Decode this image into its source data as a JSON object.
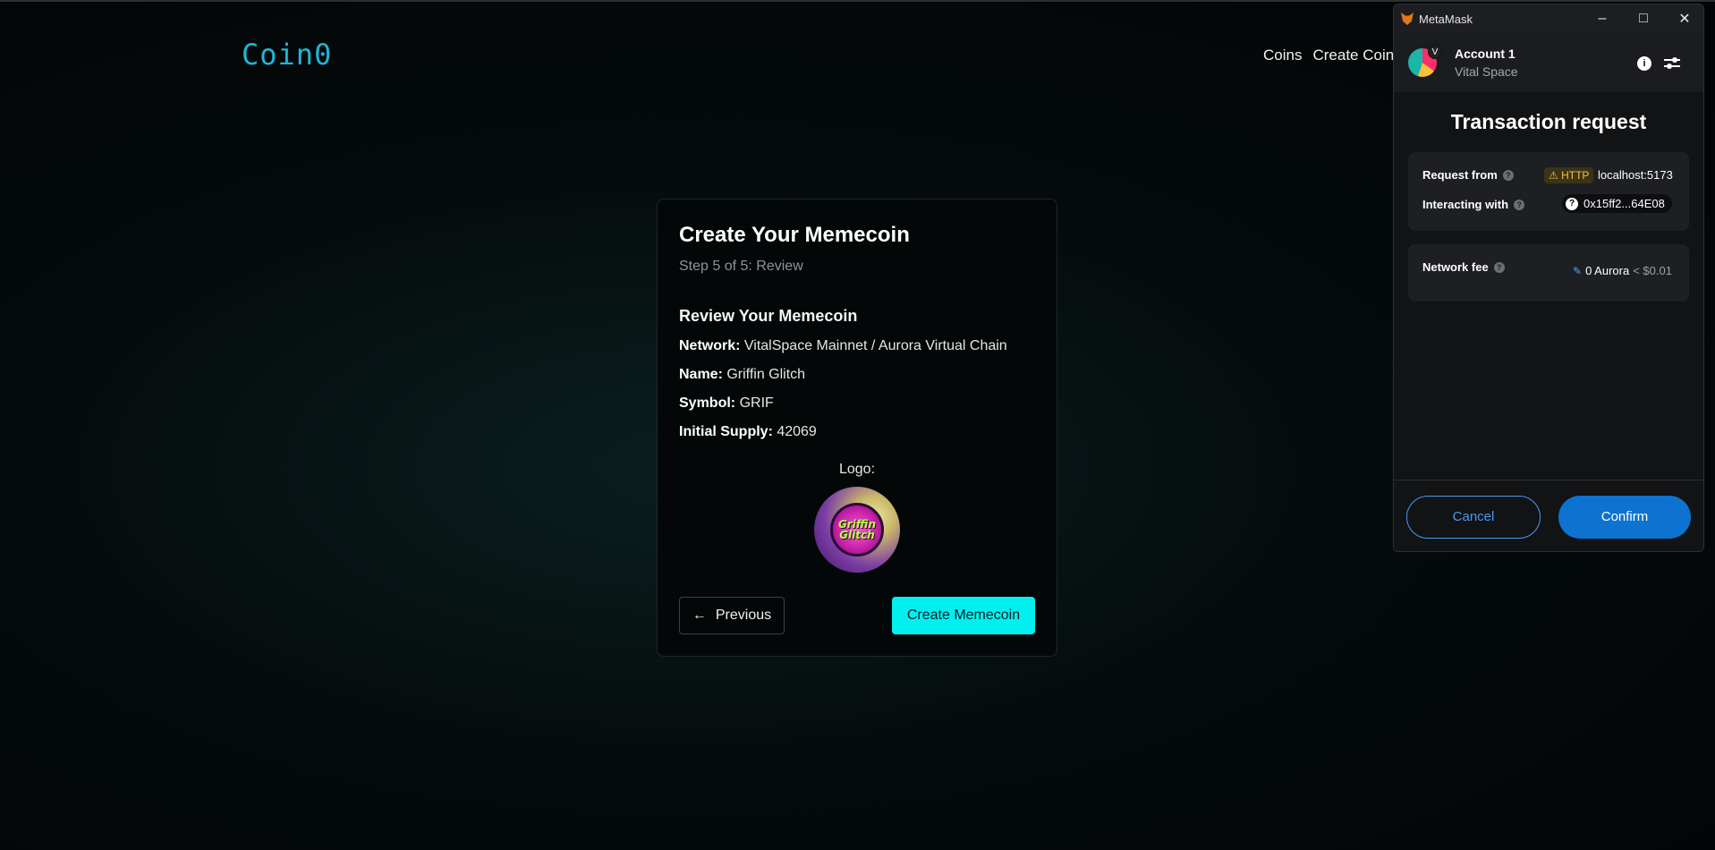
{
  "site": {
    "brand": "Coin0",
    "nav": [
      "Coins",
      "Create Coin"
    ]
  },
  "card": {
    "title": "Create Your Memecoin",
    "step": "Step 5 of 5: Review",
    "review_title": "Review Your Memecoin",
    "fields": [
      {
        "label": "Network:",
        "value": " VitalSpace Mainnet / Aurora Virtual Chain"
      },
      {
        "label": "Name:",
        "value": " Griffin Glitch"
      },
      {
        "label": "Symbol:",
        "value": " GRIF"
      },
      {
        "label": "Initial Supply:",
        "value": " 42069"
      }
    ],
    "logo_label": "Logo:",
    "logo_text_1": "Griffin",
    "logo_text_2": "Glitch",
    "prev_label": "Previous",
    "prev_icon": "arrow-left-icon",
    "create_label": "Create Memecoin"
  },
  "metamask": {
    "window_title": "MetaMask",
    "account_name": "Account 1",
    "account_initial": "V",
    "network": "Vital Space",
    "tx_title": "Transaction request",
    "request_from_label": "Request from",
    "http_label": "HTTP",
    "host": "localhost:5173",
    "interacting_label": "Interacting with",
    "address": "0x15ff2...64E08",
    "fee_label": "Network fee",
    "fee_value": "0 Aurora",
    "fee_usd": "< $0.01",
    "cancel_label": "Cancel",
    "confirm_label": "Confirm"
  },
  "colors": {
    "accent": "#00f0f0",
    "brand": "#1fb6d4",
    "mm_primary": "#0e72d1",
    "warning": "#f7c23f"
  }
}
